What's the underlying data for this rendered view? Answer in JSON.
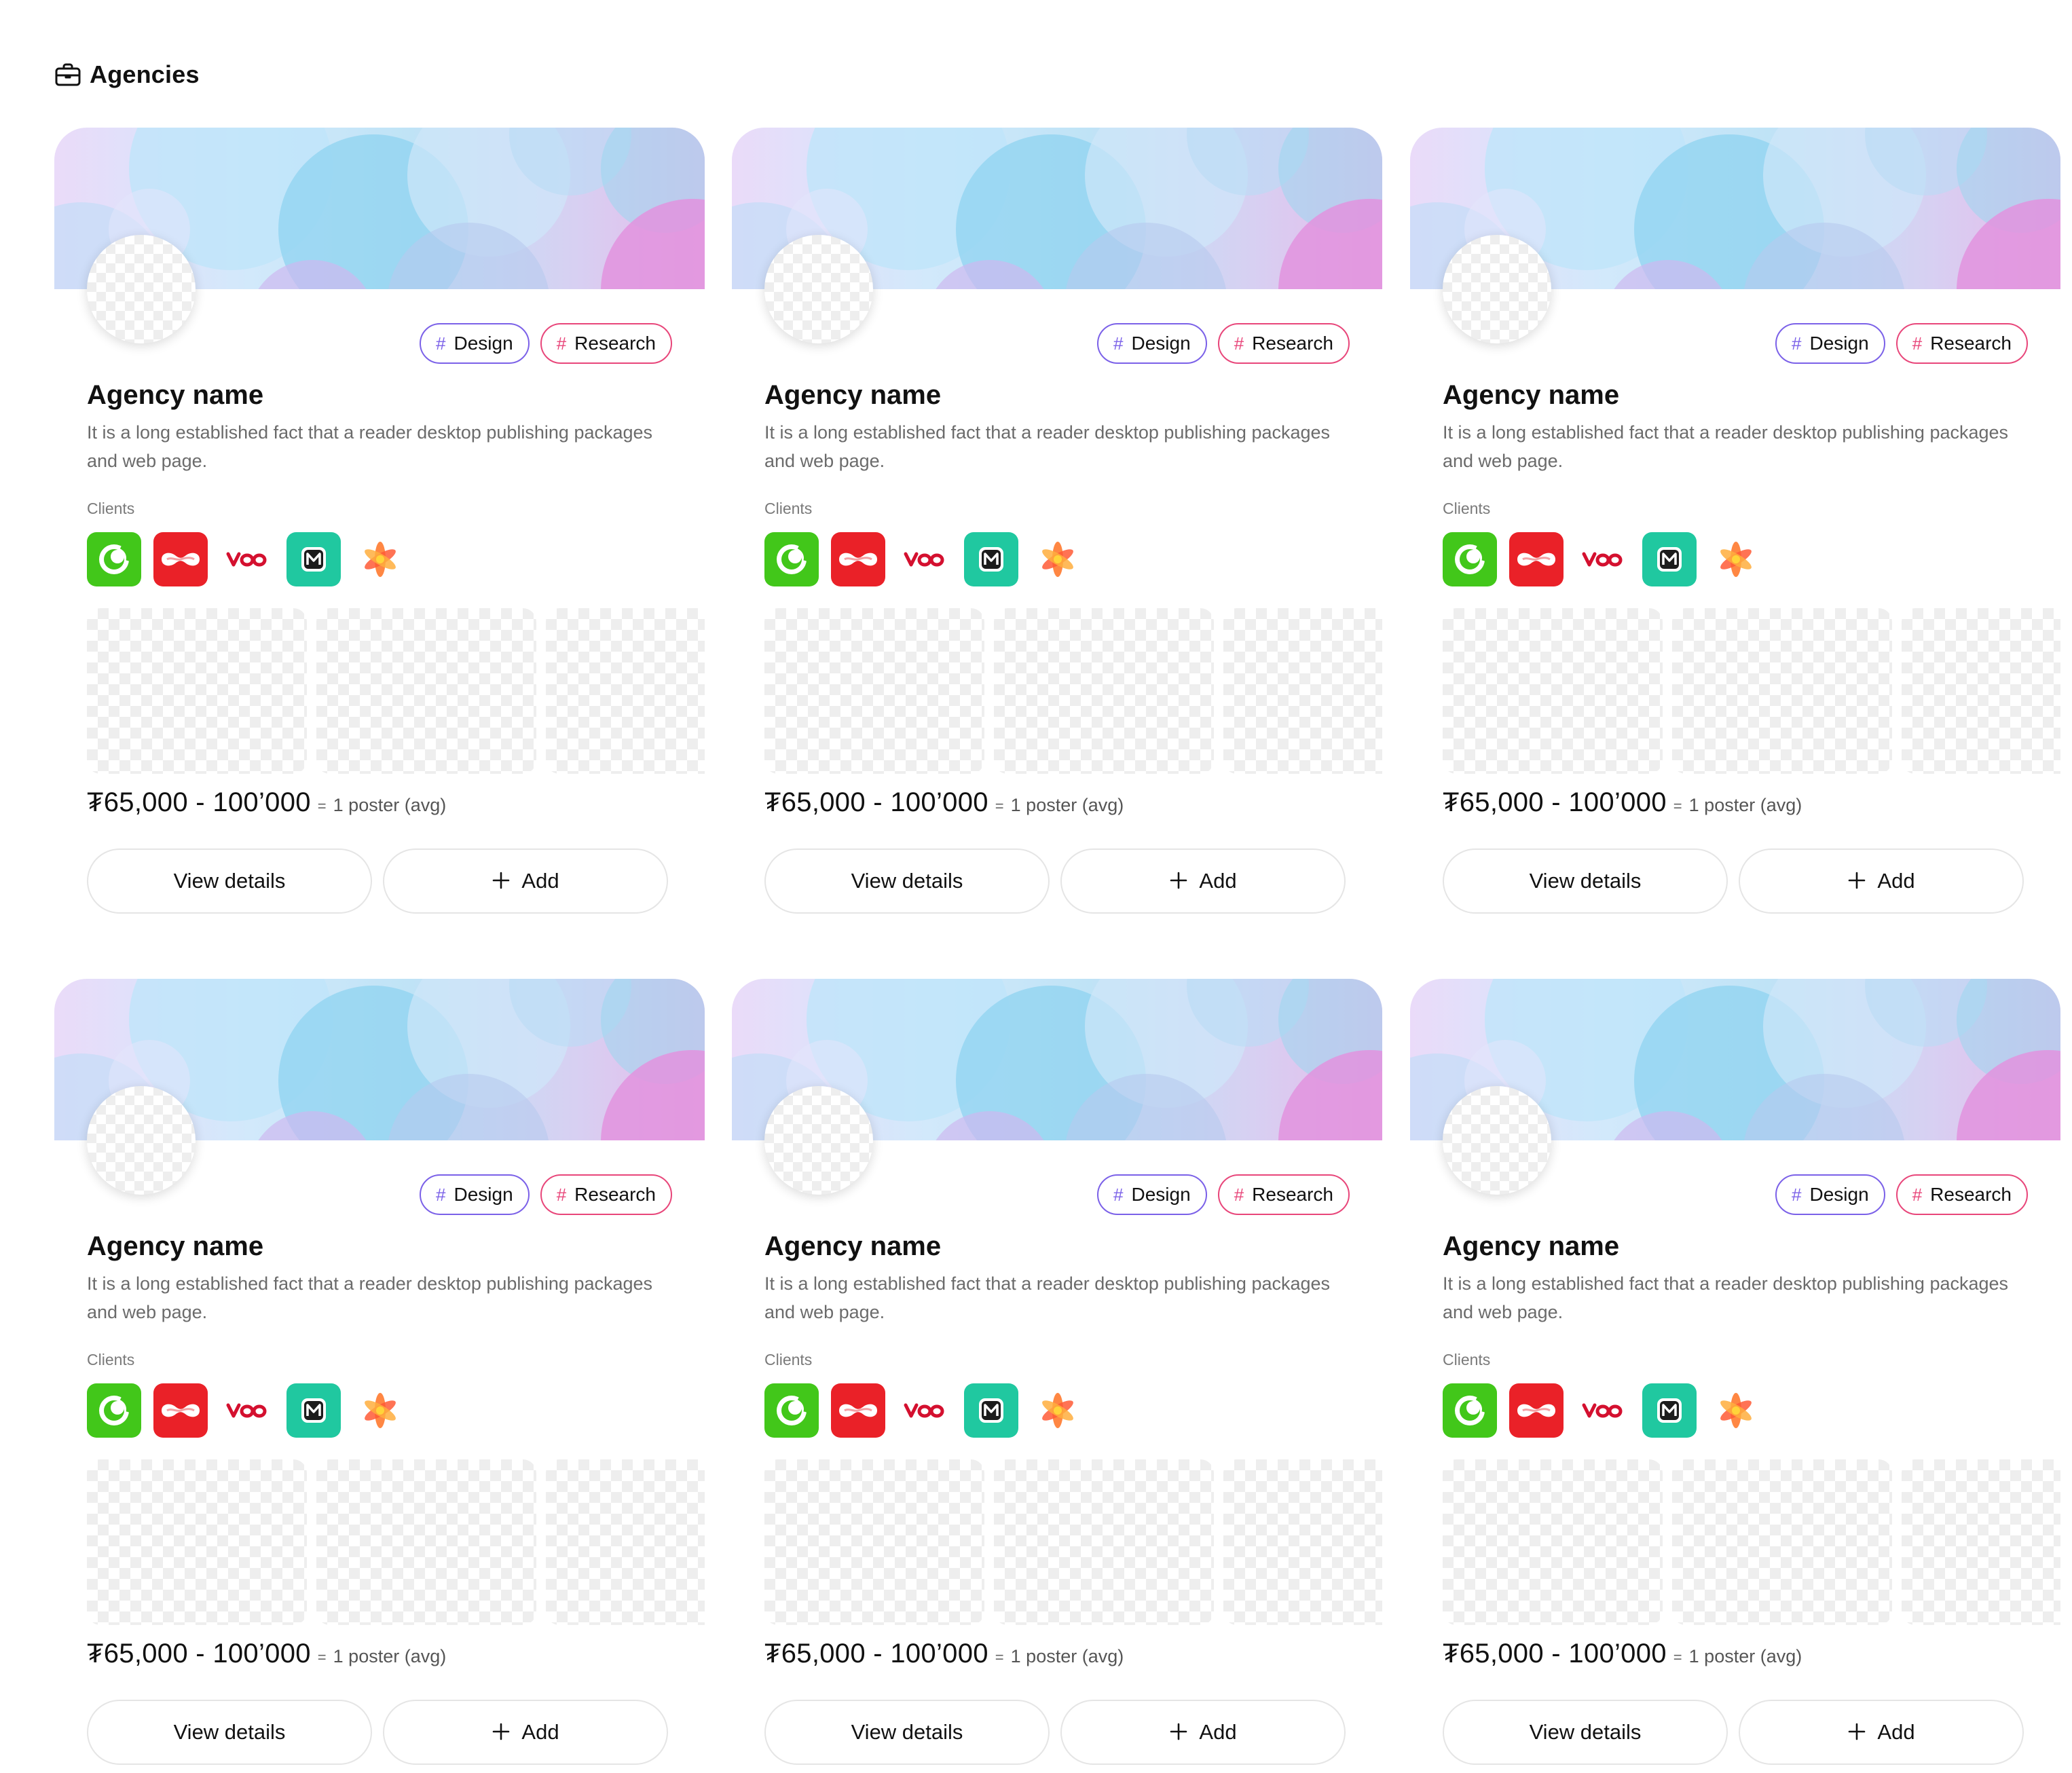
{
  "section": {
    "title": "Agencies",
    "icon": "briefcase-icon"
  },
  "cards": [
    {
      "name": "Agency name",
      "description": "It is a long established fact that a reader desktop publishing packages and web page.",
      "tags": [
        {
          "hash": "#",
          "label": "Design",
          "color": "#7b61e8"
        },
        {
          "hash": "#",
          "label": "Research",
          "color": "#e8467a"
        }
      ],
      "clients_label": "Clients",
      "clients": [
        "green-swirl-logo",
        "red-wave-logo",
        "voo-logo",
        "m-box-logo",
        "orange-asterisk-logo"
      ],
      "price": "₮65,000 - 100’000",
      "price_eq": "=",
      "price_note": "1 poster (avg)",
      "view_label": "View details",
      "add_label": "Add"
    },
    {
      "name": "Agency name",
      "description": "It is a long established fact that a reader desktop publishing packages and web page.",
      "tags": [
        {
          "hash": "#",
          "label": "Design",
          "color": "#7b61e8"
        },
        {
          "hash": "#",
          "label": "Research",
          "color": "#e8467a"
        }
      ],
      "clients_label": "Clients",
      "clients": [
        "green-swirl-logo",
        "red-wave-logo",
        "voo-logo",
        "m-box-logo",
        "orange-asterisk-logo"
      ],
      "price": "₮65,000 - 100’000",
      "price_eq": "=",
      "price_note": "1 poster (avg)",
      "view_label": "View details",
      "add_label": "Add"
    },
    {
      "name": "Agency name",
      "description": "It is a long established fact that a reader desktop publishing packages and web page.",
      "tags": [
        {
          "hash": "#",
          "label": "Design",
          "color": "#7b61e8"
        },
        {
          "hash": "#",
          "label": "Research",
          "color": "#e8467a"
        }
      ],
      "clients_label": "Clients",
      "clients": [
        "green-swirl-logo",
        "red-wave-logo",
        "voo-logo",
        "m-box-logo",
        "orange-asterisk-logo"
      ],
      "price": "₮65,000 - 100’000",
      "price_eq": "=",
      "price_note": "1 poster (avg)",
      "view_label": "View details",
      "add_label": "Add"
    },
    {
      "name": "Agency name",
      "description": "It is a long established fact that a reader desktop publishing packages and web page.",
      "tags": [
        {
          "hash": "#",
          "label": "Design",
          "color": "#7b61e8"
        },
        {
          "hash": "#",
          "label": "Research",
          "color": "#e8467a"
        }
      ],
      "clients_label": "Clients",
      "clients": [
        "green-swirl-logo",
        "red-wave-logo",
        "voo-logo",
        "m-box-logo",
        "orange-asterisk-logo"
      ],
      "price": "₮65,000 - 100’000",
      "price_eq": "=",
      "price_note": "1 poster (avg)",
      "view_label": "View details",
      "add_label": "Add"
    },
    {
      "name": "Agency name",
      "description": "It is a long established fact that a reader desktop publishing packages and web page.",
      "tags": [
        {
          "hash": "#",
          "label": "Design",
          "color": "#7b61e8"
        },
        {
          "hash": "#",
          "label": "Research",
          "color": "#e8467a"
        }
      ],
      "clients_label": "Clients",
      "clients": [
        "green-swirl-logo",
        "red-wave-logo",
        "voo-logo",
        "m-box-logo",
        "orange-asterisk-logo"
      ],
      "price": "₮65,000 - 100’000",
      "price_eq": "=",
      "price_note": "1 poster (avg)",
      "view_label": "View details",
      "add_label": "Add"
    },
    {
      "name": "Agency name",
      "description": "It is a long established fact that a reader desktop publishing packages and web page.",
      "tags": [
        {
          "hash": "#",
          "label": "Design",
          "color": "#7b61e8"
        },
        {
          "hash": "#",
          "label": "Research",
          "color": "#e8467a"
        }
      ],
      "clients_label": "Clients",
      "clients": [
        "green-swirl-logo",
        "red-wave-logo",
        "voo-logo",
        "m-box-logo",
        "orange-asterisk-logo"
      ],
      "price": "₮65,000 - 100’000",
      "price_eq": "=",
      "price_note": "1 poster (avg)",
      "view_label": "View details",
      "add_label": "Add"
    }
  ]
}
